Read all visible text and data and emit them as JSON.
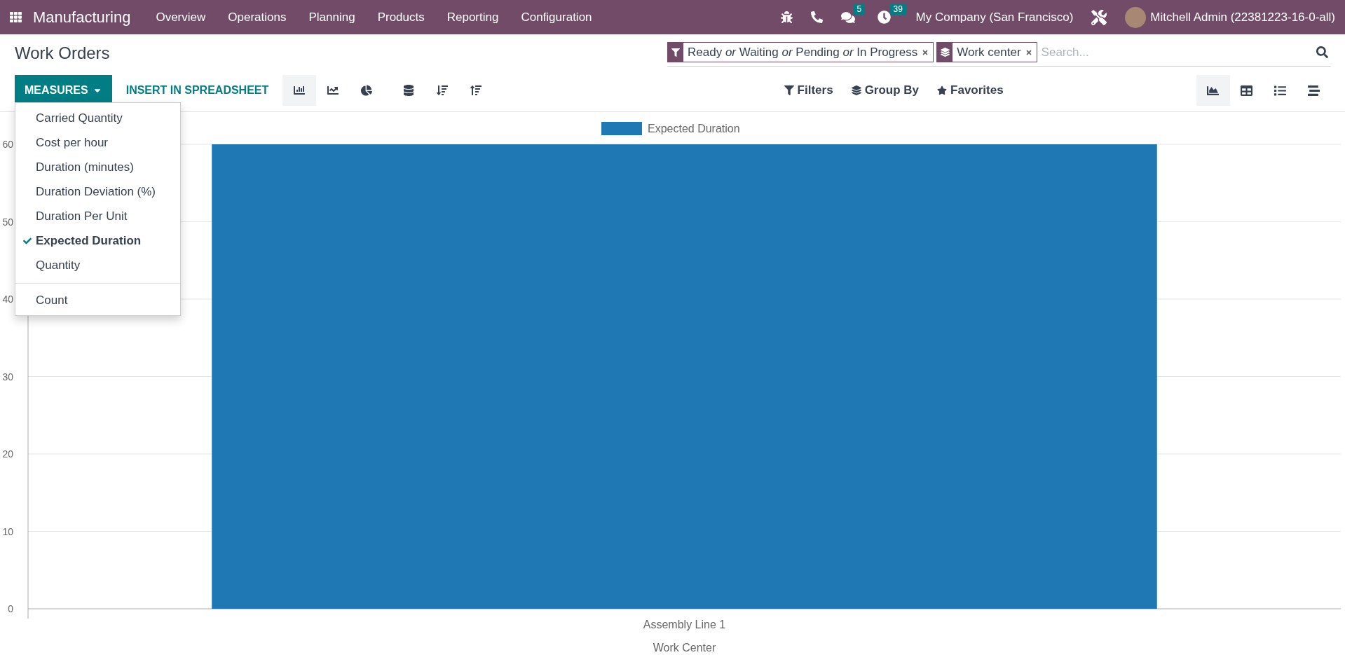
{
  "navbar": {
    "app_name": "Manufacturing",
    "menu": [
      "Overview",
      "Operations",
      "Planning",
      "Products",
      "Reporting",
      "Configuration"
    ],
    "messages_count": "5",
    "activities_count": "39",
    "company": "My Company (San Francisco)",
    "user": "Mitchell Admin (22381223-16-0-all)"
  },
  "title": "Work Orders",
  "search": {
    "facets": [
      {
        "kind": "filter",
        "text": "Ready *or* Waiting *or* Pending *or* In Progress"
      },
      {
        "kind": "group",
        "text": "Work center"
      }
    ],
    "placeholder": "Search..."
  },
  "toolbar": {
    "measures_label": "MEASURES",
    "insert_label": "INSERT IN SPREADSHEET",
    "chart_buttons": [
      {
        "kind": "bar",
        "selected": true
      },
      {
        "kind": "line",
        "selected": false
      },
      {
        "kind": "pie",
        "selected": false
      },
      {
        "kind": "stack",
        "selected": false
      },
      {
        "kind": "sort-desc",
        "selected": false
      },
      {
        "kind": "sort-asc",
        "selected": false
      }
    ],
    "search_options": [
      "Filters",
      "Group By",
      "Favorites"
    ],
    "views": [
      {
        "kind": "graph",
        "selected": true
      },
      {
        "kind": "pivot",
        "selected": false
      },
      {
        "kind": "list",
        "selected": false
      },
      {
        "kind": "gantt",
        "selected": false
      }
    ]
  },
  "measures_menu": {
    "groups": [
      [
        {
          "label": "Carried Quantity",
          "checked": false
        },
        {
          "label": "Cost per hour",
          "checked": false
        },
        {
          "label": "Duration (minutes)",
          "checked": false
        },
        {
          "label": "Duration Deviation (%)",
          "checked": false
        },
        {
          "label": "Duration Per Unit",
          "checked": false
        },
        {
          "label": "Expected Duration",
          "checked": true
        },
        {
          "label": "Quantity",
          "checked": false
        }
      ],
      [
        {
          "label": "Count",
          "checked": false
        }
      ]
    ]
  },
  "chart_data": {
    "type": "bar",
    "xlabel": "Work Center",
    "categories": [
      "Assembly Line 1"
    ],
    "series": [
      {
        "name": "Expected Duration",
        "color": "#1f77b4",
        "values": [
          60
        ]
      }
    ],
    "ylim": [
      0,
      60
    ],
    "yticks": [
      0,
      10,
      20,
      30,
      40,
      50,
      60
    ],
    "grid": true
  }
}
